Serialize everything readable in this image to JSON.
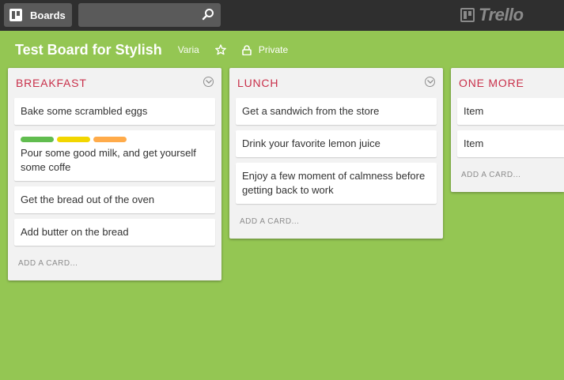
{
  "header": {
    "boards_label": "Boards",
    "search_value": "",
    "logo_text": "Trello"
  },
  "board": {
    "title": "Test Board for Stylish",
    "organization": "Varia",
    "privacy": "Private"
  },
  "lists": [
    {
      "title": "BREAKFAST",
      "add_card": "ADD A CARD...",
      "cards": [
        {
          "text": "Bake some scrambled eggs",
          "labels": []
        },
        {
          "text": "Pour some good milk, and get yourself some coffe",
          "labels": [
            "green",
            "yellow",
            "orange"
          ]
        },
        {
          "text": "Get the bread out of the oven",
          "labels": []
        },
        {
          "text": "Add butter on the bread",
          "labels": []
        }
      ]
    },
    {
      "title": "LUNCH",
      "add_card": "ADD A CARD...",
      "cards": [
        {
          "text": "Get a sandwich from the store",
          "labels": []
        },
        {
          "text": "Drink your favorite lemon juice",
          "labels": []
        },
        {
          "text": "Enjoy a few moment of calmness before getting back to work",
          "labels": []
        }
      ]
    },
    {
      "title": "ONE MORE",
      "add_card": "ADD A CARD...",
      "cards": [
        {
          "text": "Item",
          "labels": []
        },
        {
          "text": "Item",
          "labels": []
        }
      ]
    }
  ],
  "colors": {
    "background": "#94c653",
    "header": "#2f2f2f",
    "list_title": "#c9304a",
    "label_green": "#61bd4f",
    "label_yellow": "#f2d600",
    "label_orange": "#ffab4a"
  }
}
